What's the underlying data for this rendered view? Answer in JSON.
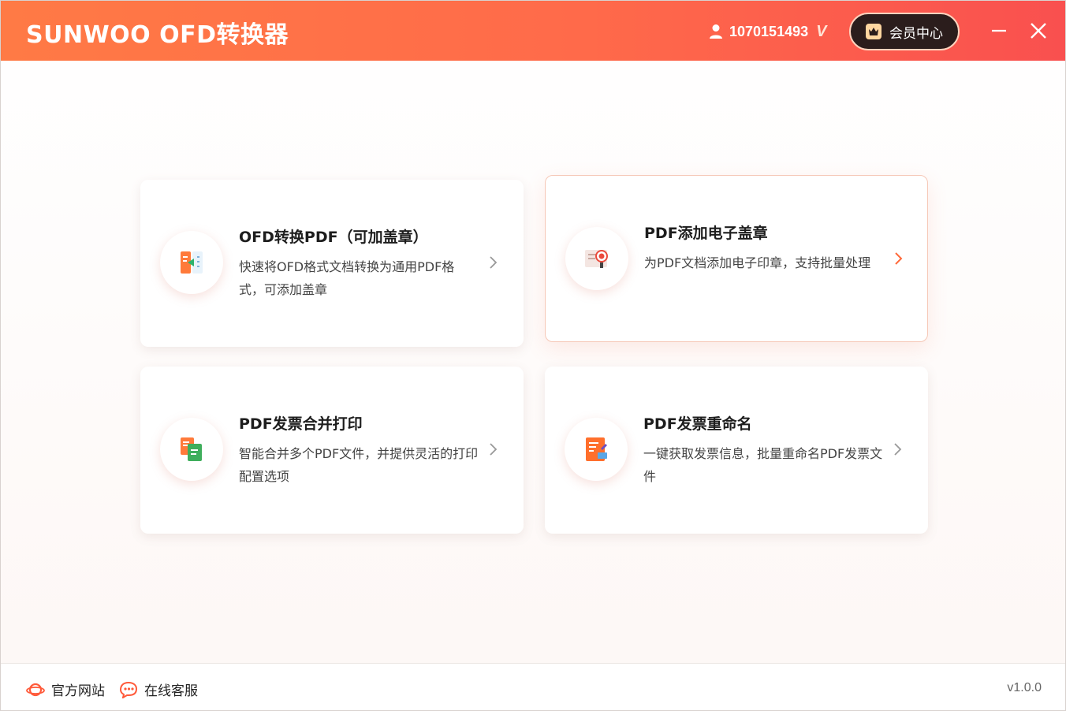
{
  "app": {
    "title": "SUNWOO OFD转换器",
    "user_id": "1070151493",
    "vip_mark": "V",
    "member_center_label": "会员中心"
  },
  "colors": {
    "accent": "#ff6a4a",
    "title_gradient_start": "#ff7a45",
    "title_gradient_end": "#f9504f",
    "member_btn_bg": "#2b1d1c"
  },
  "cards": [
    {
      "title": "OFD转换PDF（可加盖章）",
      "description": "快速将OFD格式文档转换为通用PDF格式，可添加盖章",
      "icon": "ofd-to-pdf-icon"
    },
    {
      "title": "PDF添加电子盖章",
      "description": "为PDF文档添加电子印章，支持批量处理",
      "icon": "seal-certificate-icon"
    },
    {
      "title": "PDF发票合并打印",
      "description": "智能合并多个PDF文件，并提供灵活的打印配置选项",
      "icon": "merge-documents-icon"
    },
    {
      "title": "PDF发票重命名",
      "description": "一键获取发票信息，批量重命名PDF发票文件",
      "icon": "rename-document-icon"
    }
  ],
  "footer": {
    "website_label": "官方网站",
    "support_label": "在线客服",
    "version": "v1.0.0"
  }
}
